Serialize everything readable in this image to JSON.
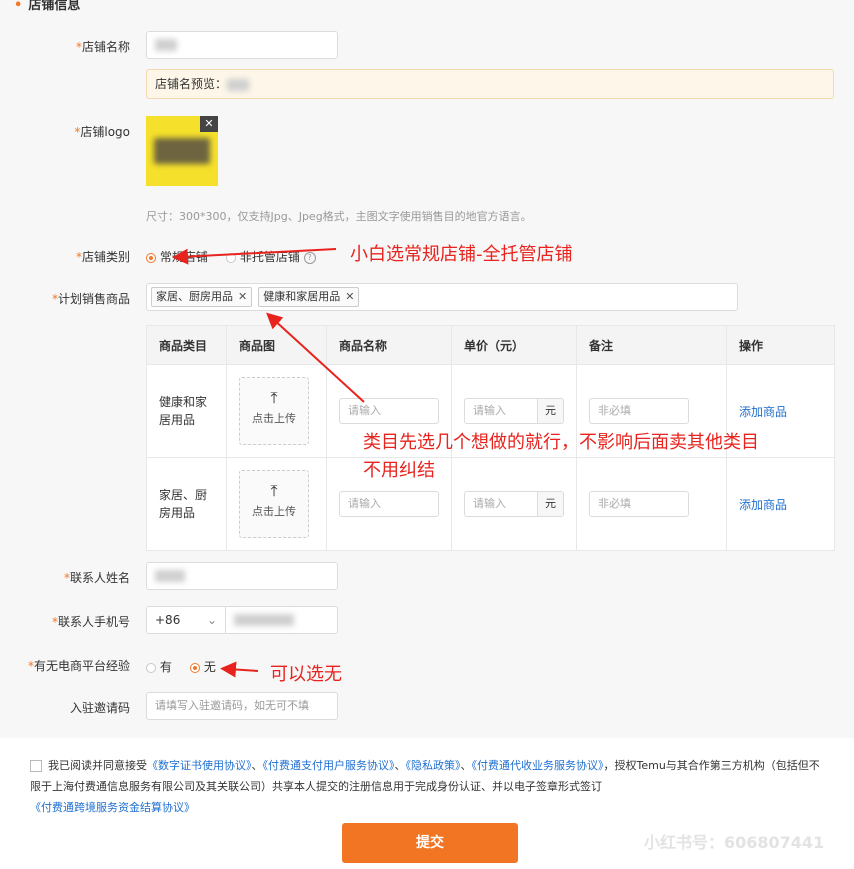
{
  "section": {
    "title": "店铺信息"
  },
  "shop_name": {
    "label": "店铺名称",
    "preview_label": "店铺名预览："
  },
  "logo": {
    "label": "店铺logo",
    "hint": "尺寸：300*300，仅支持Jpg、Jpeg格式，主图文字使用销售目的地官方语言。"
  },
  "category": {
    "label": "店铺类别",
    "options": [
      "常规店铺",
      "非托管店铺"
    ],
    "selected": "常规店铺"
  },
  "plan": {
    "label": "计划销售商品",
    "tags": [
      "家居、厨房用品",
      "健康和家居用品"
    ],
    "table": {
      "headers": [
        "商品类目",
        "商品图",
        "商品名称",
        "单价（元）",
        "备注",
        "操作"
      ],
      "rows": [
        {
          "category": "健康和家居用品",
          "upload": "点击上传",
          "name_placeholder": "请输入",
          "price_placeholder": "请输入",
          "unit": "元",
          "note_placeholder": "非必填",
          "action": "添加商品"
        },
        {
          "category": "家居、厨房用品",
          "upload": "点击上传",
          "name_placeholder": "请输入",
          "price_placeholder": "请输入",
          "unit": "元",
          "note_placeholder": "非必填",
          "action": "添加商品"
        }
      ]
    }
  },
  "contact_name": {
    "label": "联系人姓名"
  },
  "contact_phone": {
    "label": "联系人手机号",
    "country_code": "+86"
  },
  "experience": {
    "label": "有无电商平台经验",
    "options": [
      "有",
      "无"
    ],
    "selected": "无"
  },
  "invite": {
    "label": "入驻邀请码",
    "placeholder": "请填写入驻邀请码，如无可不填"
  },
  "agreement": {
    "prefix": "我已阅读并同意接受",
    "links": [
      "《数字证书使用协议》",
      "《付费通支付用户服务协议》",
      "《隐私政策》",
      "《付费通代收业务服务协议》",
      "《付费通跨境服务资金结算协议》"
    ],
    "sep": "、",
    "middle": "，授权Temu与其合作第三方机构（包括但不限于上海付费通信息服务有限公司及其关联公司）共享本人提交的注册信息用于完成身份认证、并以电子签章形式签订"
  },
  "submit_label": "提交",
  "annotations": {
    "a1": "小白选常规店铺-全托管店铺",
    "a2_line1": "类目先选几个想做的就行，不影响后面卖其他类目",
    "a2_line2": "不用纠结",
    "a3": "可以选无"
  },
  "watermark": "小红书号：606807441",
  "colors": {
    "accent": "#f27524",
    "annotation": "#e8231e",
    "link": "#1f6fd1"
  }
}
